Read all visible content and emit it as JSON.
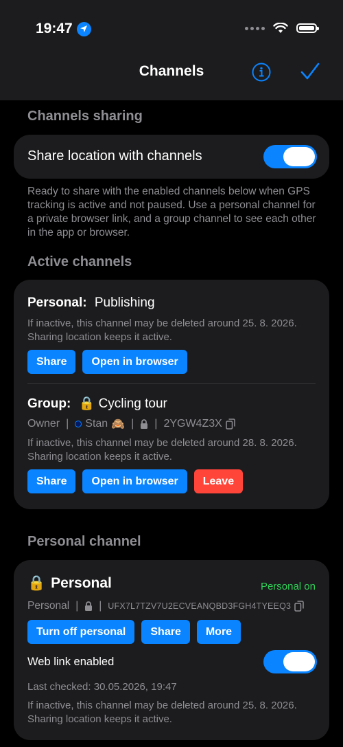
{
  "status": {
    "time": "19:47"
  },
  "nav": {
    "title": "Channels"
  },
  "sharing": {
    "header": "Channels sharing",
    "toggle_label": "Share location with channels",
    "toggle_on": true,
    "note": "Ready to share with the enabled channels below when GPS tracking is active and not paused. Use a personal channel for a private browser link, and a group channel to see each other in the app or browser."
  },
  "active": {
    "header": "Active channels",
    "personal": {
      "kind": "Personal:",
      "name": "Publishing",
      "note": "If inactive, this channel may be deleted around 25. 8. 2026. Sharing location keeps it active.",
      "share": "Share",
      "open": "Open in browser"
    },
    "group": {
      "kind": "Group:",
      "lock": "🔒",
      "name": "Cycling tour",
      "role": "Owner",
      "sep": "|",
      "member": "Stan",
      "member_emoji": "🙈",
      "code": "2YGW4Z3X",
      "note": "If inactive, this channel may be deleted around 28. 8. 2026. Sharing location keeps it active.",
      "share": "Share",
      "open": "Open in browser",
      "leave": "Leave"
    }
  },
  "personal_channel": {
    "header": "Personal channel",
    "lock": "🔒",
    "title": "Personal",
    "status": "Personal on",
    "status_color": "#30d158",
    "meta_label": "Personal",
    "sep": "|",
    "code": "UFX7L7TZV7U2ECVEANQBD3FGH4TYEEQ3",
    "turn_off": "Turn off personal",
    "share": "Share",
    "more": "More",
    "weblink_label": "Web link enabled",
    "weblink_on": true,
    "last_checked": "Last checked: 30.05.2026, 19:47",
    "note": "If inactive, this channel may be deleted around 25. 8. 2026. Sharing location keeps it active."
  },
  "colors": {
    "accent": "#0a84ff",
    "danger": "#ff453a",
    "card": "#1c1c1e"
  }
}
